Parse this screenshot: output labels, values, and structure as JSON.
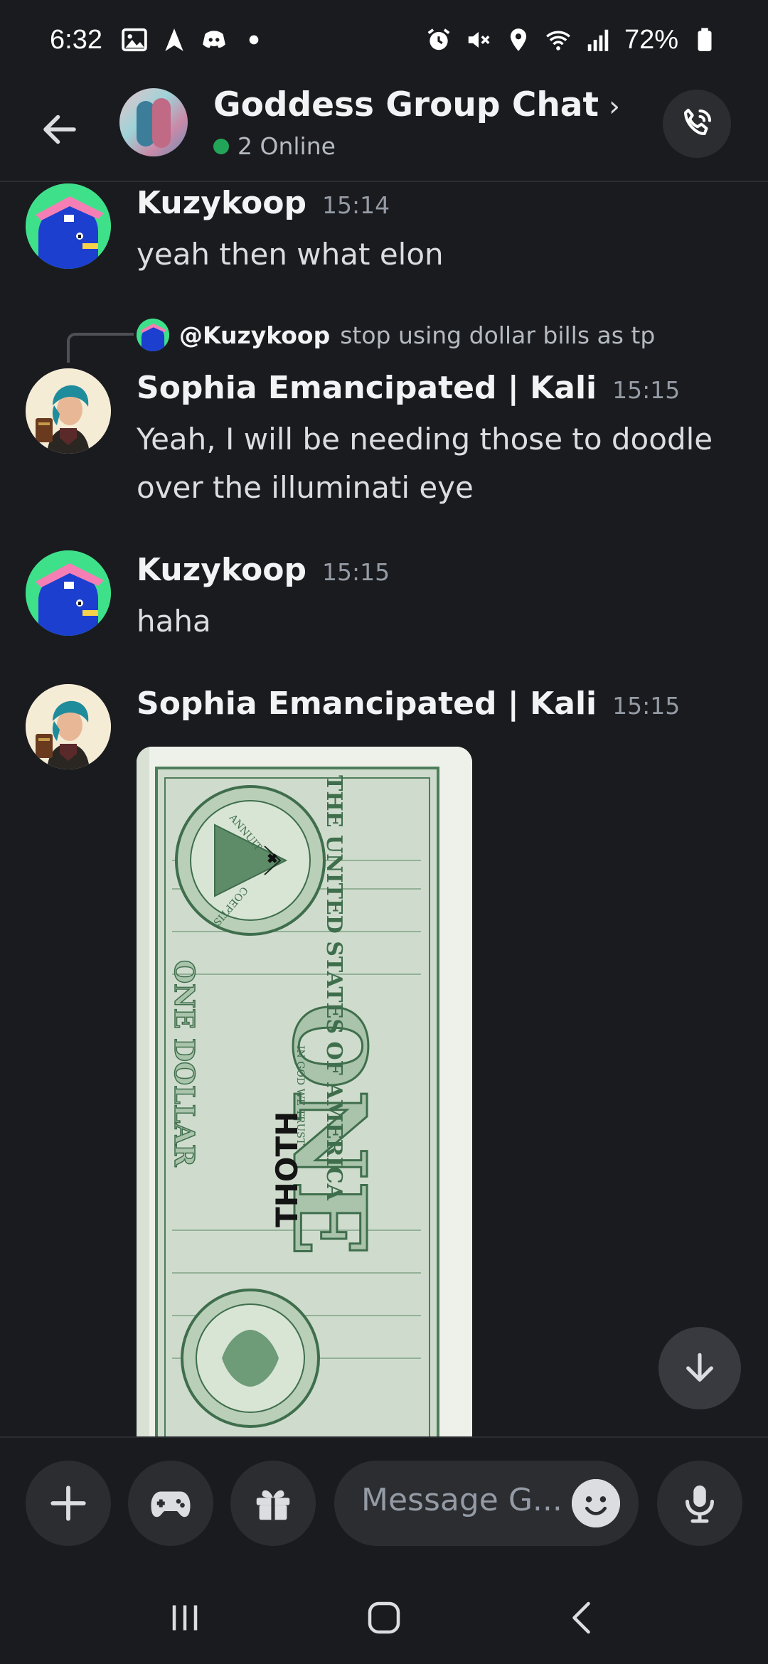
{
  "status_bar": {
    "time": "6:32",
    "battery": "72%",
    "left_icons": [
      "image-icon",
      "navigation-icon",
      "discord-icon",
      "dot-icon"
    ],
    "right_icons": [
      "alarm-icon",
      "mute-icon",
      "location-icon",
      "wifi-icon",
      "signal-icon",
      "battery-icon"
    ]
  },
  "header": {
    "title": "Goddess Group Chat",
    "chevron": "›",
    "online_status": "2 Online",
    "online_color": "#23a559"
  },
  "messages": [
    {
      "author": "Kuzykoop",
      "timestamp": "15:14",
      "text": "yeah then what elon"
    },
    {
      "reply_to": {
        "mention": "@Kuzykoop",
        "preview": "stop using dollar bills as tp"
      },
      "author": "Sophia Emancipated | Kali",
      "timestamp": "15:15",
      "text": "Yeah,  I will be needing those to doodle over the illuminati eye"
    },
    {
      "author": "Kuzykoop",
      "timestamp": "15:15",
      "text": "haha"
    },
    {
      "author": "Sophia Emancipated | Kali",
      "timestamp": "15:15",
      "attachment": {
        "type": "image",
        "subject": "one-dollar-bill",
        "bill_text_top": "THE UNITED STATES OF AMERICA",
        "bill_text_motto": "IN GOD WE TRUST",
        "bill_text_denomination": "ONE",
        "bill_text_bottom": "ONE DOLLAR",
        "bill_text_seal_top": "ANNUIT",
        "bill_text_seal_bottom": "COEPTIS",
        "doodle_text": "THOTH"
      }
    }
  ],
  "composer": {
    "placeholder": "Message G...",
    "buttons": [
      "plus-icon",
      "gamepad-icon",
      "gift-icon",
      "emoji-icon",
      "microphone-icon"
    ]
  },
  "nav_bar": {
    "buttons": [
      "recents-icon",
      "home-icon",
      "back-icon"
    ]
  },
  "colors": {
    "background": "#1a1b1f",
    "surface": "#2b2d31",
    "text_primary": "#f2f3f5",
    "text_secondary": "#949ba4",
    "bill_green": "#4d7d5a"
  }
}
